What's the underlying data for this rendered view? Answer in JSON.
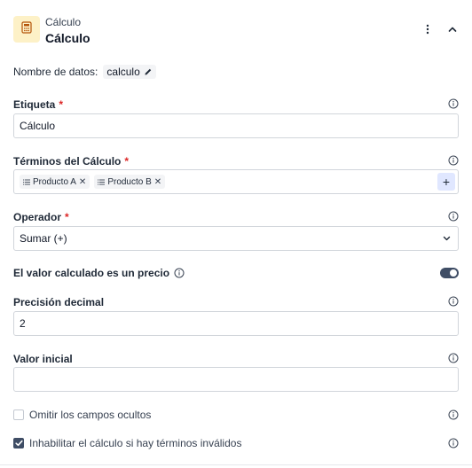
{
  "header": {
    "subtitle": "Cálculo",
    "title": "Cálculo",
    "badge_icon": "calculator-icon",
    "badge_color": "#fdf1c7"
  },
  "data_name": {
    "label": "Nombre de datos:",
    "value": "calculo"
  },
  "etiqueta": {
    "label": "Etiqueta",
    "required_mark": "*",
    "value": "Cálculo"
  },
  "terminos": {
    "label": "Términos del Cálculo",
    "required_mark": "*",
    "chips": [
      {
        "label": "Producto A"
      },
      {
        "label": "Producto B"
      }
    ],
    "add_label": "+"
  },
  "operador": {
    "label": "Operador",
    "required_mark": "*",
    "selected": "Sumar (+)"
  },
  "precio_toggle": {
    "label": "El valor calculado es un precio",
    "on": true
  },
  "precision": {
    "label": "Precisión decimal",
    "value": "2"
  },
  "valor_inicial": {
    "label": "Valor inicial",
    "value": ""
  },
  "omitir": {
    "label": "Omitir los campos ocultos",
    "checked": false
  },
  "inhabilitar": {
    "label": "Inhabilitar el cálculo si hay términos inválidos",
    "checked": true
  },
  "colors": {
    "accent": "#3f4d65",
    "required": "#dc2626",
    "chip_bg": "#f3f4f6",
    "add_bg": "#e0e7ff"
  }
}
